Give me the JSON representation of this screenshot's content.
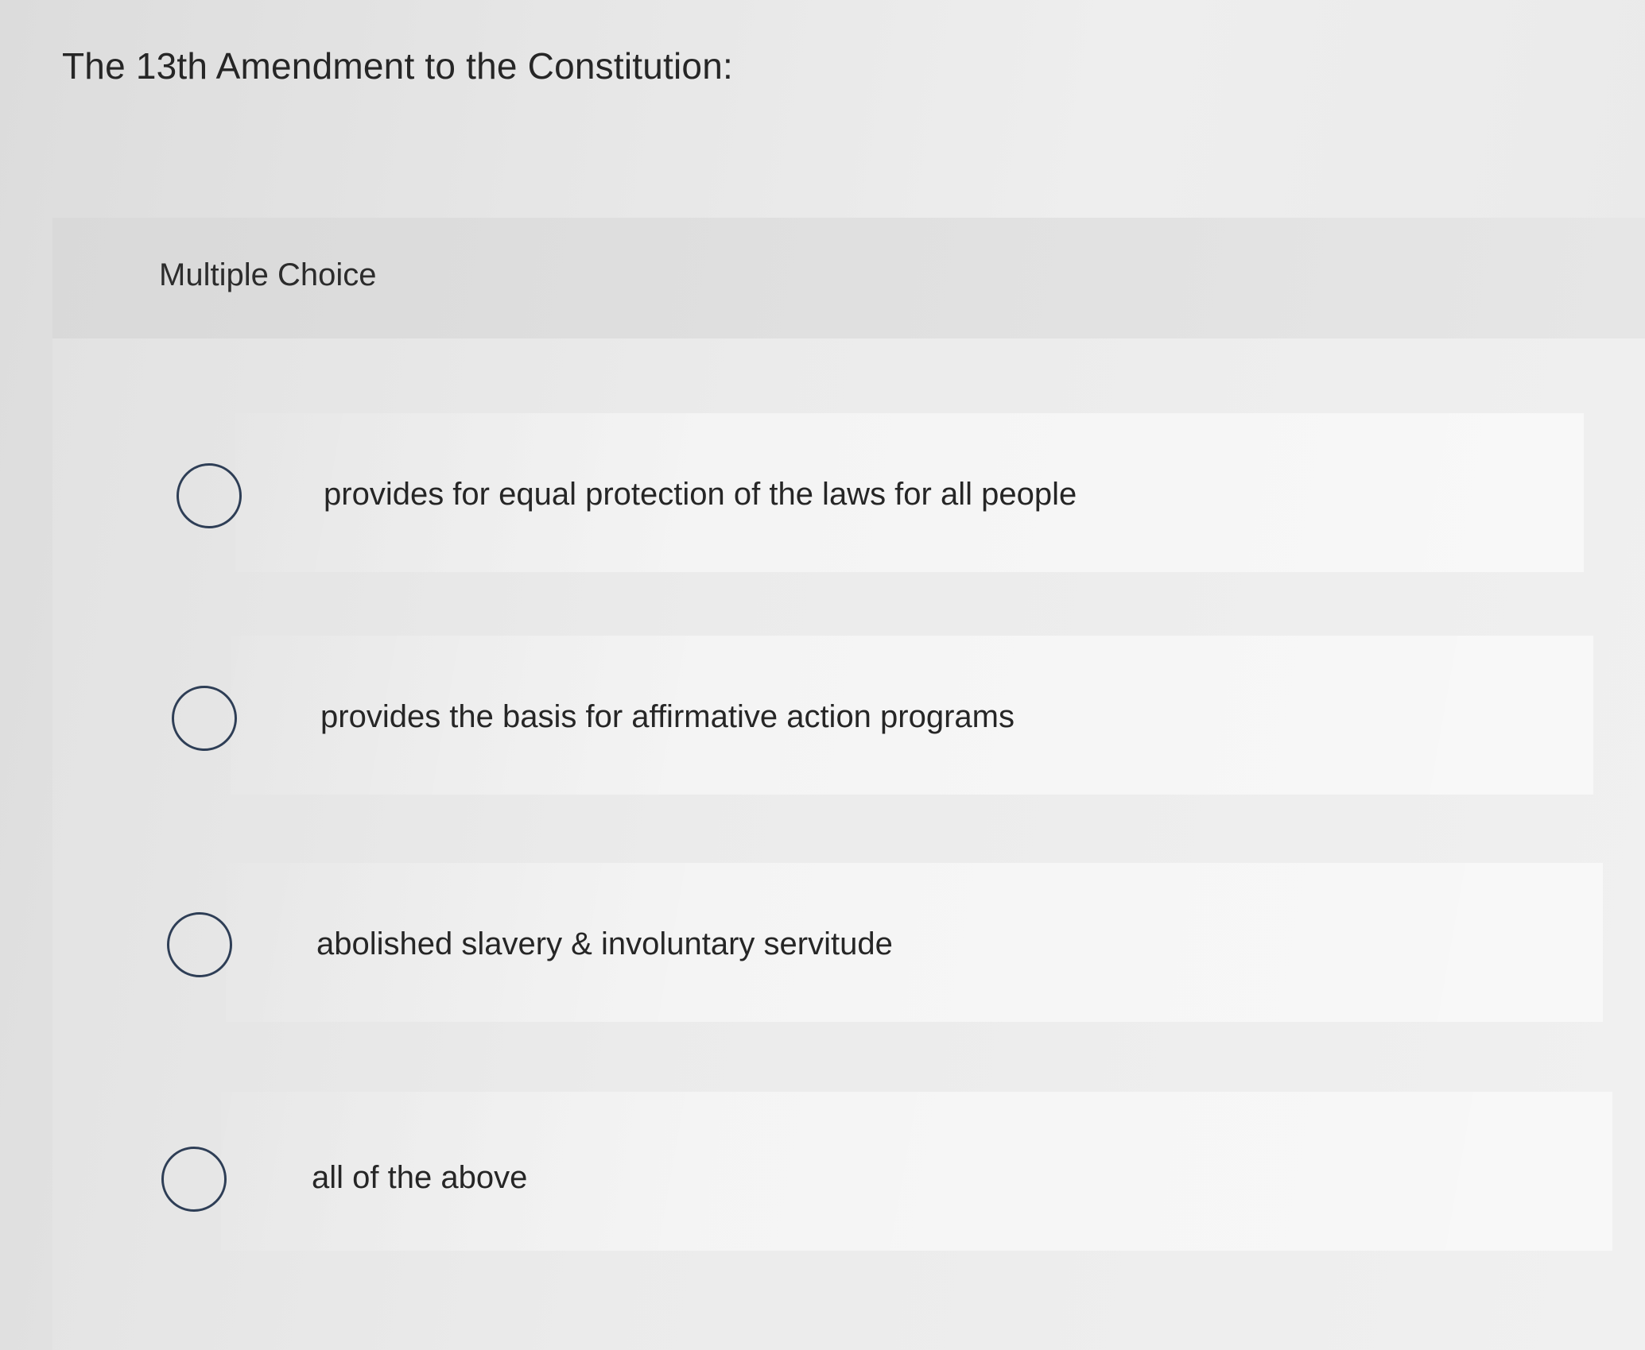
{
  "question": {
    "text": "The 13th Amendment to the Constitution:"
  },
  "quiz": {
    "type_label": "Multiple Choice",
    "options": [
      {
        "label": "provides for equal protection of the laws for all people",
        "selected": false
      },
      {
        "label": "provides the basis for affirmative action programs",
        "selected": false
      },
      {
        "label": "abolished slavery & involuntary servitude",
        "selected": false
      },
      {
        "label": "all of the above",
        "selected": false
      }
    ]
  }
}
